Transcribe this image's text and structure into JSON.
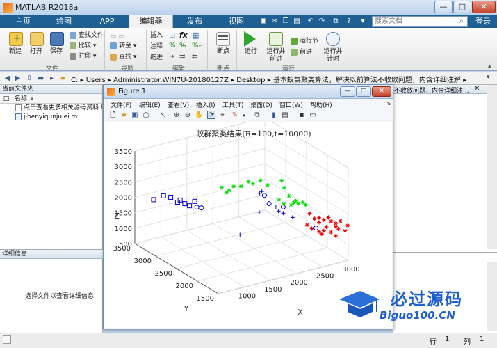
{
  "window": {
    "title": "MATLAB R2018a",
    "min_label": "—",
    "max_label": "□",
    "close_label": "✕"
  },
  "ribbon_tabs": [
    {
      "label": "主页"
    },
    {
      "label": "绘图"
    },
    {
      "label": "APP"
    },
    {
      "label": "编辑器"
    },
    {
      "label": "发布"
    },
    {
      "label": "视图"
    }
  ],
  "search": {
    "placeholder": "搜索文档"
  },
  "login_label": "登录",
  "ribbon": {
    "file_group": {
      "label": "文件",
      "new": "新建",
      "open": "打开",
      "save": "保存",
      "find_files": "查找文件",
      "compare": "比较",
      "print": "打印"
    },
    "nav_group": {
      "label": "导航",
      "goto": "转至",
      "find": "查找"
    },
    "edit_group": {
      "label": "编辑",
      "insert": "插入",
      "comment": "注释",
      "indent": "缩进"
    },
    "breakpoint_group": {
      "label": "断点",
      "breakpoint": "断点"
    },
    "run_group": {
      "label": "运行",
      "run": "运行",
      "run_advance_1": "运行并",
      "run_advance_2": "前进",
      "run_section": "运行节",
      "advance": "前进",
      "run_time_1": "运行并",
      "run_time_2": "计时"
    }
  },
  "address": {
    "path": "C:  ▸  Users  ▸  Administrator.WIN7U-20180127Z  ▸  Desktop  ▸  基本蚁群聚类算法，解决以前算法不收敛问题，内含详细注解  ▸"
  },
  "current_folder": {
    "title": "当前文件夹",
    "column_name": "名称",
    "sort_indicator": "▴",
    "files": [
      {
        "name": "点击查看更多相关源码资料 h"
      },
      {
        "name": "jibenyiqunjulei.m"
      }
    ]
  },
  "details": {
    "title": "详细信息",
    "empty_message": "选择文件以查看详细信息"
  },
  "command_window_snippet": "不收敛问题，内含详细注...",
  "statusbar": {
    "row_label": "行",
    "row_value": "1",
    "col_label": "列",
    "col_value": "1"
  },
  "figure": {
    "title": "Figure 1",
    "menus": [
      {
        "label": "文件(F)"
      },
      {
        "label": "编辑(E)"
      },
      {
        "label": "查看(V)"
      },
      {
        "label": "插入(I)"
      },
      {
        "label": "工具(T)"
      },
      {
        "label": "桌面(D)"
      },
      {
        "label": "窗口(W)"
      },
      {
        "label": "帮助(H)"
      }
    ]
  },
  "chart_data": {
    "type": "scatter",
    "title": "蚁群聚类结果(R=100,t=10000)",
    "xlabel": "X",
    "ylabel": "Y",
    "zlabel": "Z",
    "xlim": [
      500,
      3000
    ],
    "ylim": [
      1500,
      3500
    ],
    "zlim": [
      500,
      3500
    ],
    "x_ticks": [
      1000,
      1500,
      2000,
      2500,
      3000
    ],
    "y_ticks": [
      1500,
      2000,
      2500,
      3000,
      3500
    ],
    "z_ticks": [
      500,
      1000,
      1500,
      2000,
      2500,
      3000,
      3500
    ],
    "grid": true,
    "series": [
      {
        "marker": "square",
        "color": "#0000cc",
        "points": [
          [
            700,
            3300,
            2000
          ],
          [
            850,
            3250,
            2100
          ],
          [
            950,
            3200,
            2050
          ],
          [
            1050,
            3100,
            2000
          ],
          [
            1100,
            3050,
            1900
          ],
          [
            1250,
            3000,
            1950
          ],
          [
            1150,
            3000,
            1850
          ],
          [
            1000,
            3100,
            1950
          ]
        ]
      },
      {
        "marker": "circle",
        "color": "#0000cc",
        "points": [
          [
            1250,
            2950,
            1800
          ],
          [
            1300,
            2900,
            1800
          ],
          [
            2150,
            2450,
            2200
          ],
          [
            2350,
            2250,
            1900
          ],
          [
            2700,
            1900,
            1350
          ],
          [
            2200,
            2400,
            1950
          ]
        ]
      },
      {
        "marker": "plus",
        "color": "#0000cc",
        "points": [
          [
            2100,
            2500,
            2250
          ],
          [
            2050,
            2450,
            1700
          ],
          [
            2250,
            2300,
            1900
          ],
          [
            2300,
            2300,
            1750
          ],
          [
            2350,
            2250,
            1700
          ],
          [
            2450,
            2150,
            1600
          ],
          [
            1800,
            2600,
            950
          ],
          [
            2100,
            2450,
            2350
          ]
        ]
      },
      {
        "marker": "asterisk",
        "color": "#00dd00",
        "points": [
          [
            1650,
            2850,
            2350
          ],
          [
            1750,
            2800,
            2250
          ],
          [
            1900,
            2700,
            2400
          ],
          [
            2000,
            2650,
            2550
          ],
          [
            2150,
            2550,
            2600
          ],
          [
            2050,
            2600,
            2500
          ],
          [
            2250,
            2500,
            2450
          ],
          [
            2400,
            2350,
            2650
          ],
          [
            2450,
            2350,
            2400
          ],
          [
            2500,
            2300,
            2150
          ],
          [
            2550,
            2250,
            1950
          ],
          [
            2350,
            2350,
            2050
          ],
          [
            2400,
            2300,
            1950
          ],
          [
            2600,
            2200,
            1950
          ],
          [
            2650,
            2150,
            2000
          ],
          [
            2700,
            2150,
            1900
          ],
          [
            2500,
            2250,
            1900
          ],
          [
            1700,
            2800,
            2200
          ],
          [
            1800,
            2750,
            2400
          ],
          [
            2550,
            2200,
            2050
          ]
        ]
      },
      {
        "marker": "asterisk",
        "color": "#ee0000",
        "points": [
          [
            2700,
            2050,
            1700
          ],
          [
            2800,
            1950,
            1600
          ],
          [
            2850,
            1900,
            1550
          ],
          [
            2950,
            1850,
            1500
          ],
          [
            3000,
            1800,
            1350
          ],
          [
            2900,
            1850,
            1650
          ],
          [
            3050,
            1800,
            1250
          ],
          [
            2800,
            1950,
            1450
          ],
          [
            2750,
            2000,
            1550
          ],
          [
            2900,
            1900,
            1300
          ],
          [
            2850,
            1900,
            1200
          ],
          [
            2950,
            1850,
            1150
          ],
          [
            3100,
            1700,
            1250
          ],
          [
            3000,
            1800,
            1450
          ],
          [
            2800,
            1950,
            1150
          ],
          [
            2700,
            2000,
            1250
          ],
          [
            2650,
            2050,
            1350
          ],
          [
            3050,
            1750,
            1550
          ],
          [
            3150,
            1700,
            1400
          ],
          [
            2850,
            1950,
            1050
          ],
          [
            3000,
            1800,
            1050
          ]
        ]
      }
    ]
  },
  "watermark": {
    "brand_cn": "必过源码",
    "brand_en": "Biguo100.CN"
  }
}
